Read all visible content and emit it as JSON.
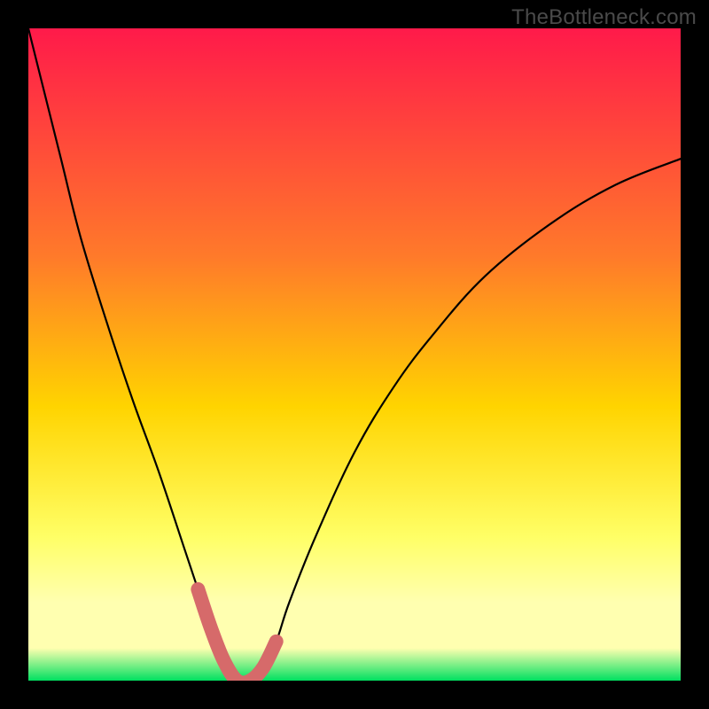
{
  "watermark": "TheBottleneck.com",
  "colors": {
    "bg": "#000000",
    "watermark": "#4a4a4a",
    "gradient_top": "#ff1a4a",
    "gradient_mid1": "#ff7a2a",
    "gradient_mid2": "#ffd400",
    "gradient_mid3": "#ffff66",
    "gradient_mid4": "#ffffb0",
    "gradient_bottom": "#00e060",
    "curve": "#000000",
    "marker": "#d66a6a"
  },
  "chart_data": {
    "type": "line",
    "title": "",
    "xlabel": "",
    "ylabel": "",
    "xlim": [
      0,
      100
    ],
    "ylim": [
      0,
      100
    ],
    "x": [
      0,
      2,
      5,
      8,
      12,
      16,
      20,
      24,
      26,
      28,
      30,
      32,
      34,
      36,
      38,
      40,
      44,
      50,
      56,
      62,
      70,
      80,
      90,
      100
    ],
    "values": [
      100,
      92,
      80,
      68,
      55,
      43,
      32,
      20,
      14,
      8,
      3,
      0,
      0,
      2,
      6,
      12,
      22,
      35,
      45,
      53,
      62,
      70,
      76,
      80
    ],
    "marker_segment": {
      "x": [
        26,
        28,
        30,
        32,
        34,
        36,
        38
      ],
      "values": [
        14,
        8,
        3,
        0,
        0,
        2,
        6
      ]
    },
    "gradient_stops_pct": [
      0,
      35,
      58,
      78,
      88,
      95,
      100
    ]
  }
}
